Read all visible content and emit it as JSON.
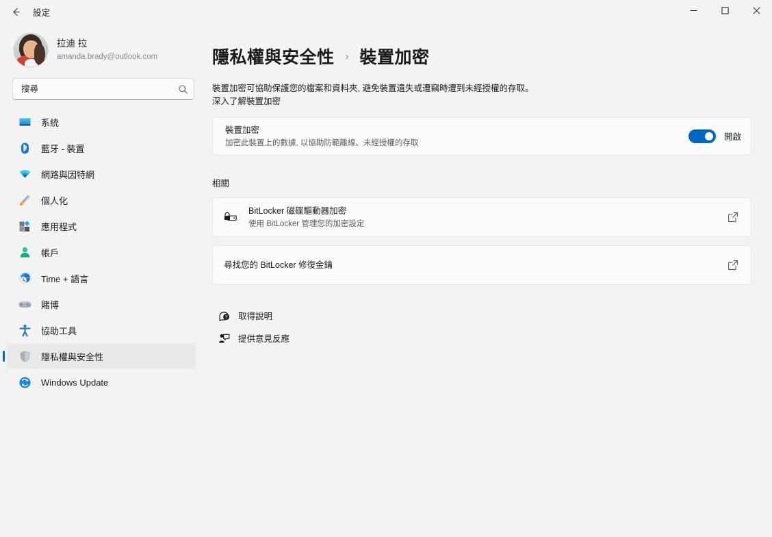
{
  "titlebar": {
    "back_label": "back-arrow",
    "app_title": "設定",
    "minimize_label": "minimize",
    "maximize_label": "maximize",
    "close_label": "close"
  },
  "sidebar": {
    "account": {
      "name": "拉迪 拉",
      "email": "amanda.brady@outlook.com"
    },
    "search": {
      "placeholder": "搜尋",
      "value": ""
    },
    "items": [
      {
        "label": "系統",
        "icon": "monitor-icon",
        "selected": false
      },
      {
        "label": "藍牙 - 裝置",
        "icon": "bluetooth-icon",
        "selected": false
      },
      {
        "label": "網路與因特網",
        "icon": "wifi-icon",
        "selected": false
      },
      {
        "label": "個人化",
        "icon": "paintbrush-icon",
        "selected": false
      },
      {
        "label": "應用程式",
        "icon": "apps-icon",
        "selected": false
      },
      {
        "label": "帳戶",
        "icon": "account-icon",
        "selected": false
      },
      {
        "label": "Time + 語言",
        "icon": "time-language-icon",
        "selected": false
      },
      {
        "label": "賭博",
        "icon": "gaming-icon",
        "selected": false
      },
      {
        "label": "協助工具",
        "icon": "accessibility-icon",
        "selected": false
      },
      {
        "label": "隱私權與安全性",
        "icon": "shield-icon",
        "selected": true
      },
      {
        "label": "Windows Update",
        "icon": "update-icon",
        "selected": false
      }
    ]
  },
  "main": {
    "breadcrumb": {
      "parent": "隱私權與安全性",
      "separator": "›",
      "current": "裝置加密"
    },
    "description": "裝置加密可協助保護您的檔案和資料夾, 避免裝置遺失或遭竊時遭到未經授權的存取。",
    "learn_more": "深入了解裝置加密",
    "device_encryption": {
      "title": "裝置加密",
      "subtitle": "加密此裝置上的數據, 以協助防範離線、未經授權的存取",
      "toggle_state_label": "開啟",
      "toggle_on": true,
      "accent_color": "#0067c0"
    },
    "related_heading": "相關",
    "related_items": [
      {
        "title": "BitLocker 磁碟驅動器加密",
        "subtitle": "使用 BitLocker 管理您的加密設定",
        "icon": "bitlocker-lock-icon",
        "action_icon": "external-link-icon"
      },
      {
        "title": "尋找您的 BitLocker 修復金鑰",
        "subtitle": "",
        "icon": "",
        "action_icon": "external-link-icon"
      }
    ],
    "footer_links": [
      {
        "label": "取得說明",
        "icon": "help-icon"
      },
      {
        "label": "提供意見反應",
        "icon": "feedback-icon"
      }
    ]
  }
}
